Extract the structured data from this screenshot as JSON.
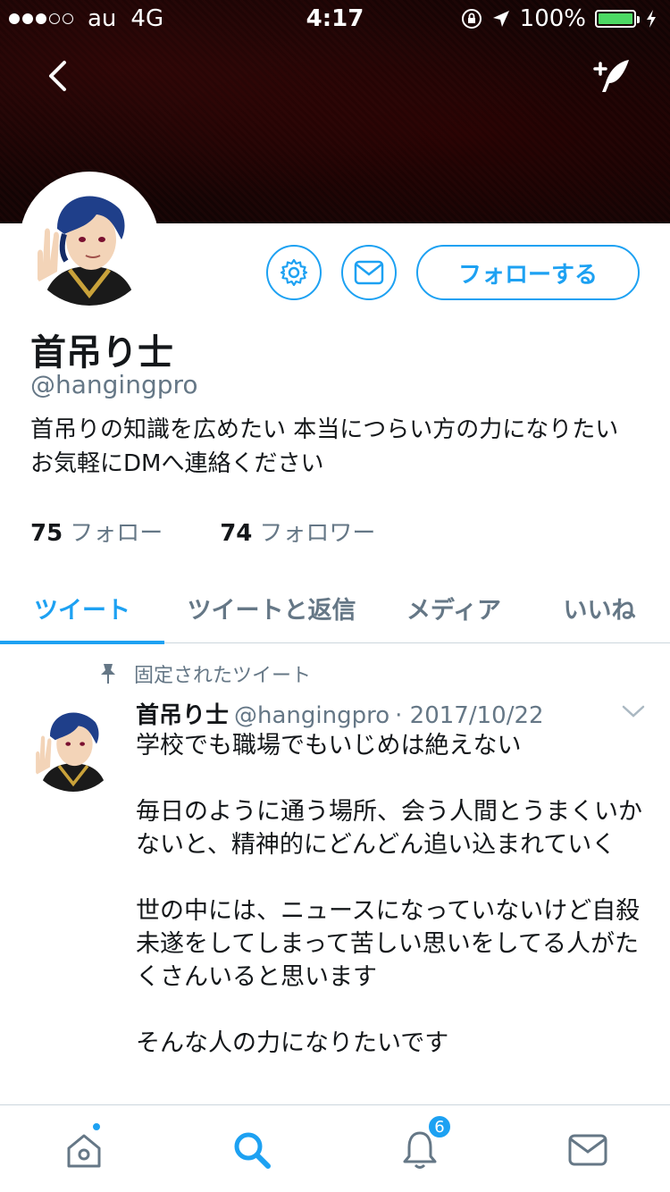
{
  "status_bar": {
    "carrier": "au",
    "network": "4G",
    "time": "4:17",
    "battery": "100%",
    "battery_level": 1.0,
    "signal_bars": 3,
    "signal_total": 5
  },
  "profile": {
    "display_name": "首吊り士",
    "handle": "@hangingpro",
    "bio": "首吊りの知識を広めたい 本当につらい方の力になりたい お気軽にDMへ連絡ください",
    "following_count": "75",
    "following_label": "フォロー",
    "followers_count": "74",
    "followers_label": "フォロワー",
    "follow_button": "フォローする"
  },
  "tabs": [
    {
      "label": "ツイート",
      "active": true
    },
    {
      "label": "ツイートと返信",
      "active": false
    },
    {
      "label": "メディア",
      "active": false
    },
    {
      "label": "いいね",
      "active": false
    }
  ],
  "pinned_tweet": {
    "pinned_label": "固定されたツイート",
    "author_name": "首吊り士",
    "author_handle": "@hangingpro",
    "date": "· 2017/10/22",
    "paragraphs": [
      "学校でも職場でもいじめは絶えない",
      "毎日のように通う場所、会う人間とうまくいかないと、精神的にどんどん追い込まれていく",
      "世の中には、ニュースになっていないけど自殺未遂をしてしまって苦しい思いをしてる人がたくさんいると思います",
      "そんな人の力になりたいです"
    ]
  },
  "bottom_nav": {
    "notifications_badge": "6"
  },
  "icons": {
    "back": "back-chevron-icon",
    "compose": "compose-quill-icon",
    "settings": "gear-icon",
    "message": "envelope-icon",
    "pin": "pin-icon",
    "caret": "chevron-down-icon",
    "home": "home-icon",
    "search": "search-icon",
    "notifications": "bell-icon",
    "messages": "envelope-icon"
  },
  "colors": {
    "accent": "#1da1f2",
    "text_primary": "#14171a",
    "text_secondary": "#657786",
    "battery": "#4cd964"
  }
}
